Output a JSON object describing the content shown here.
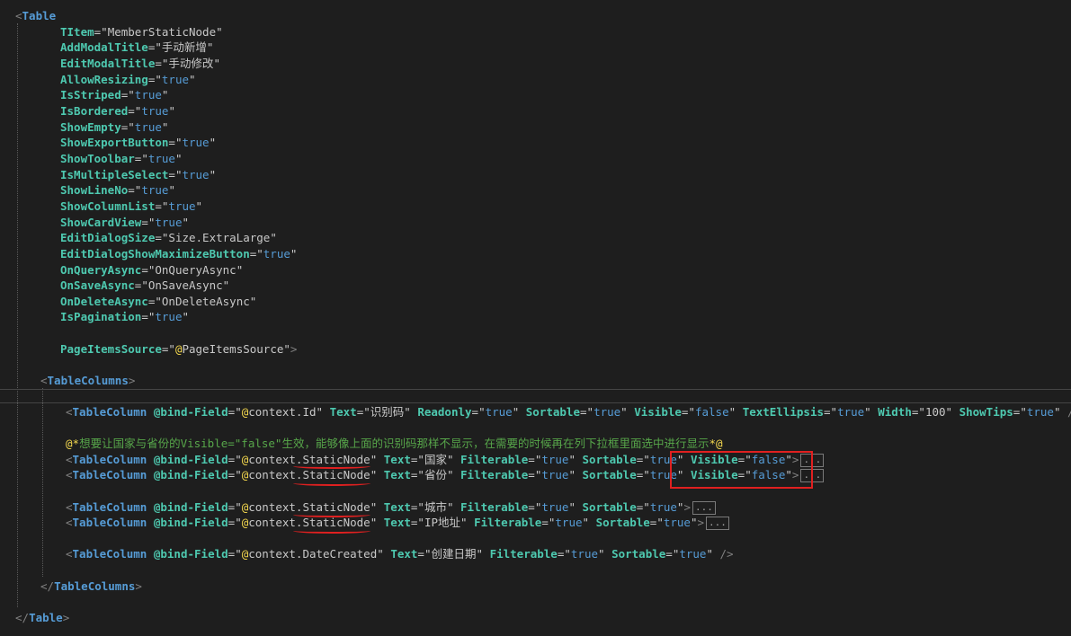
{
  "lines": [
    [
      [
        "t",
        "<"
      ],
      [
        "e",
        "Table"
      ]
    ],
    [
      [
        "a",
        "TItem"
      ],
      [
        "op",
        "="
      ],
      [
        "q",
        "\""
      ],
      [
        "s",
        "MemberStaticNode"
      ],
      [
        "q",
        "\""
      ]
    ],
    [
      [
        "a",
        "AddModalTitle"
      ],
      [
        "op",
        "="
      ],
      [
        "q",
        "\""
      ],
      [
        "s",
        "手动新增"
      ],
      [
        "q",
        "\""
      ]
    ],
    [
      [
        "a",
        "EditModalTitle"
      ],
      [
        "op",
        "="
      ],
      [
        "q",
        "\""
      ],
      [
        "s",
        "手动修改"
      ],
      [
        "q",
        "\""
      ]
    ],
    [
      [
        "a",
        "AllowResizing"
      ],
      [
        "op",
        "="
      ],
      [
        "q",
        "\""
      ],
      [
        "v",
        "true"
      ],
      [
        "q",
        "\""
      ]
    ],
    [
      [
        "a",
        "IsStriped"
      ],
      [
        "op",
        "="
      ],
      [
        "q",
        "\""
      ],
      [
        "v",
        "true"
      ],
      [
        "q",
        "\""
      ]
    ],
    [
      [
        "a",
        "IsBordered"
      ],
      [
        "op",
        "="
      ],
      [
        "q",
        "\""
      ],
      [
        "v",
        "true"
      ],
      [
        "q",
        "\""
      ]
    ],
    [
      [
        "a",
        "ShowEmpty"
      ],
      [
        "op",
        "="
      ],
      [
        "q",
        "\""
      ],
      [
        "v",
        "true"
      ],
      [
        "q",
        "\""
      ]
    ],
    [
      [
        "a",
        "ShowExportButton"
      ],
      [
        "op",
        "="
      ],
      [
        "q",
        "\""
      ],
      [
        "v",
        "true"
      ],
      [
        "q",
        "\""
      ]
    ],
    [
      [
        "a",
        "ShowToolbar"
      ],
      [
        "op",
        "="
      ],
      [
        "q",
        "\""
      ],
      [
        "v",
        "true"
      ],
      [
        "q",
        "\""
      ]
    ],
    [
      [
        "a",
        "IsMultipleSelect"
      ],
      [
        "op",
        "="
      ],
      [
        "q",
        "\""
      ],
      [
        "v",
        "true"
      ],
      [
        "q",
        "\""
      ]
    ],
    [
      [
        "a",
        "ShowLineNo"
      ],
      [
        "op",
        "="
      ],
      [
        "q",
        "\""
      ],
      [
        "v",
        "true"
      ],
      [
        "q",
        "\""
      ]
    ],
    [
      [
        "a",
        "ShowColumnList"
      ],
      [
        "op",
        "="
      ],
      [
        "q",
        "\""
      ],
      [
        "v",
        "true"
      ],
      [
        "q",
        "\""
      ]
    ],
    [
      [
        "a",
        "ShowCardView"
      ],
      [
        "op",
        "="
      ],
      [
        "q",
        "\""
      ],
      [
        "v",
        "true"
      ],
      [
        "q",
        "\""
      ]
    ],
    [
      [
        "a",
        "EditDialogSize"
      ],
      [
        "op",
        "="
      ],
      [
        "q",
        "\""
      ],
      [
        "s",
        "Size.ExtraLarge"
      ],
      [
        "q",
        "\""
      ]
    ],
    [
      [
        "a",
        "EditDialogShowMaximizeButton"
      ],
      [
        "op",
        "="
      ],
      [
        "q",
        "\""
      ],
      [
        "v",
        "true"
      ],
      [
        "q",
        "\""
      ]
    ],
    [
      [
        "a",
        "OnQueryAsync"
      ],
      [
        "op",
        "="
      ],
      [
        "q",
        "\""
      ],
      [
        "s",
        "OnQueryAsync"
      ],
      [
        "q",
        "\""
      ]
    ],
    [
      [
        "a",
        "OnSaveAsync"
      ],
      [
        "op",
        "="
      ],
      [
        "q",
        "\""
      ],
      [
        "s",
        "OnSaveAsync"
      ],
      [
        "q",
        "\""
      ]
    ],
    [
      [
        "a",
        "OnDeleteAsync"
      ],
      [
        "op",
        "="
      ],
      [
        "q",
        "\""
      ],
      [
        "s",
        "OnDeleteAsync"
      ],
      [
        "q",
        "\""
      ]
    ],
    [
      [
        "a",
        "IsPagination"
      ],
      [
        "op",
        "="
      ],
      [
        "q",
        "\""
      ],
      [
        "v",
        "true"
      ],
      [
        "q",
        "\""
      ]
    ],
    [
      [
        "a",
        "PageItemsSource"
      ],
      [
        "op",
        "="
      ],
      [
        "q",
        "\""
      ],
      [
        "at",
        "@"
      ],
      [
        "s",
        "PageItemsSource"
      ],
      [
        "q",
        "\""
      ],
      [
        "t",
        ">"
      ]
    ],
    [
      [
        "t",
        "<"
      ],
      [
        "e",
        "TableColumns"
      ],
      [
        "t",
        ">"
      ]
    ],
    [
      [
        "t",
        "<"
      ],
      [
        "e",
        "TableColumn"
      ],
      [
        "op",
        " "
      ],
      [
        "a",
        "@bind-Field"
      ],
      [
        "op",
        "="
      ],
      [
        "q",
        "\""
      ],
      [
        "at",
        "@"
      ],
      [
        "s",
        "context.Id"
      ],
      [
        "q",
        "\""
      ],
      [
        "op",
        " "
      ],
      [
        "a",
        "Text"
      ],
      [
        "op",
        "="
      ],
      [
        "q",
        "\""
      ],
      [
        "s",
        "识别码"
      ],
      [
        "q",
        "\""
      ],
      [
        "op",
        " "
      ],
      [
        "a",
        "Readonly"
      ],
      [
        "op",
        "="
      ],
      [
        "q",
        "\""
      ],
      [
        "v",
        "true"
      ],
      [
        "q",
        "\""
      ],
      [
        "op",
        " "
      ],
      [
        "a",
        "Sortable"
      ],
      [
        "op",
        "="
      ],
      [
        "q",
        "\""
      ],
      [
        "v",
        "true"
      ],
      [
        "q",
        "\""
      ],
      [
        "op",
        " "
      ],
      [
        "a",
        "Visible"
      ],
      [
        "op",
        "="
      ],
      [
        "q",
        "\""
      ],
      [
        "v",
        "false"
      ],
      [
        "q",
        "\""
      ],
      [
        "op",
        " "
      ],
      [
        "a",
        "TextEllipsis"
      ],
      [
        "op",
        "="
      ],
      [
        "q",
        "\""
      ],
      [
        "v",
        "true"
      ],
      [
        "q",
        "\""
      ],
      [
        "op",
        " "
      ],
      [
        "a",
        "Width"
      ],
      [
        "op",
        "="
      ],
      [
        "q",
        "\""
      ],
      [
        "s",
        "100"
      ],
      [
        "q",
        "\""
      ],
      [
        "op",
        " "
      ],
      [
        "a",
        "ShowTips"
      ],
      [
        "op",
        "="
      ],
      [
        "q",
        "\""
      ],
      [
        "v",
        "true"
      ],
      [
        "q",
        "\""
      ],
      [
        "op",
        " "
      ],
      [
        "t",
        "/>"
      ]
    ],
    [
      [
        "cm",
        "@*"
      ],
      [
        "c",
        "想要让国家与省份的Visible=\"false\"生效，能够像上面的识别码那样不显示，在需要的时候再在列下拉框里面选中进行显示"
      ],
      [
        "cm",
        "*@"
      ]
    ],
    [
      [
        "t",
        "<"
      ],
      [
        "e",
        "TableColumn"
      ],
      [
        "op",
        " "
      ],
      [
        "a",
        "@bind-Field"
      ],
      [
        "op",
        "="
      ],
      [
        "q",
        "\""
      ],
      [
        "at",
        "@"
      ],
      [
        "s",
        "context.StaticNode"
      ],
      [
        "q",
        "\""
      ],
      [
        "op",
        " "
      ],
      [
        "a",
        "Text"
      ],
      [
        "op",
        "="
      ],
      [
        "q",
        "\""
      ],
      [
        "s",
        "国家"
      ],
      [
        "q",
        "\""
      ],
      [
        "op",
        " "
      ],
      [
        "a",
        "Filterable"
      ],
      [
        "op",
        "="
      ],
      [
        "q",
        "\""
      ],
      [
        "v",
        "true"
      ],
      [
        "q",
        "\""
      ],
      [
        "op",
        " "
      ],
      [
        "a",
        "Sortable"
      ],
      [
        "op",
        "="
      ],
      [
        "q",
        "\""
      ],
      [
        "v",
        "true"
      ],
      [
        "q",
        "\""
      ],
      [
        "op",
        " "
      ],
      [
        "a",
        "Visible"
      ],
      [
        "op",
        "="
      ],
      [
        "q",
        "\""
      ],
      [
        "v",
        "false"
      ],
      [
        "q",
        "\""
      ],
      [
        "t",
        ">"
      ],
      [
        "coll",
        "..."
      ]
    ],
    [
      [
        "t",
        "<"
      ],
      [
        "e",
        "TableColumn"
      ],
      [
        "op",
        " "
      ],
      [
        "a",
        "@bind-Field"
      ],
      [
        "op",
        "="
      ],
      [
        "q",
        "\""
      ],
      [
        "at",
        "@"
      ],
      [
        "s",
        "context.StaticNode"
      ],
      [
        "q",
        "\""
      ],
      [
        "op",
        " "
      ],
      [
        "a",
        "Text"
      ],
      [
        "op",
        "="
      ],
      [
        "q",
        "\""
      ],
      [
        "s",
        "省份"
      ],
      [
        "q",
        "\""
      ],
      [
        "op",
        " "
      ],
      [
        "a",
        "Filterable"
      ],
      [
        "op",
        "="
      ],
      [
        "q",
        "\""
      ],
      [
        "v",
        "true"
      ],
      [
        "q",
        "\""
      ],
      [
        "op",
        " "
      ],
      [
        "a",
        "Sortable"
      ],
      [
        "op",
        "="
      ],
      [
        "q",
        "\""
      ],
      [
        "v",
        "true"
      ],
      [
        "q",
        "\""
      ],
      [
        "op",
        " "
      ],
      [
        "a",
        "Visible"
      ],
      [
        "op",
        "="
      ],
      [
        "q",
        "\""
      ],
      [
        "v",
        "false"
      ],
      [
        "q",
        "\""
      ],
      [
        "t",
        ">"
      ],
      [
        "coll",
        "..."
      ]
    ],
    [
      [
        "t",
        "<"
      ],
      [
        "e",
        "TableColumn"
      ],
      [
        "op",
        " "
      ],
      [
        "a",
        "@bind-Field"
      ],
      [
        "op",
        "="
      ],
      [
        "q",
        "\""
      ],
      [
        "at",
        "@"
      ],
      [
        "s",
        "context.StaticNode"
      ],
      [
        "q",
        "\""
      ],
      [
        "op",
        " "
      ],
      [
        "a",
        "Text"
      ],
      [
        "op",
        "="
      ],
      [
        "q",
        "\""
      ],
      [
        "s",
        "城市"
      ],
      [
        "q",
        "\""
      ],
      [
        "op",
        " "
      ],
      [
        "a",
        "Filterable"
      ],
      [
        "op",
        "="
      ],
      [
        "q",
        "\""
      ],
      [
        "v",
        "true"
      ],
      [
        "q",
        "\""
      ],
      [
        "op",
        " "
      ],
      [
        "a",
        "Sortable"
      ],
      [
        "op",
        "="
      ],
      [
        "q",
        "\""
      ],
      [
        "v",
        "true"
      ],
      [
        "q",
        "\""
      ],
      [
        "t",
        ">"
      ],
      [
        "coll",
        "..."
      ]
    ],
    [
      [
        "t",
        "<"
      ],
      [
        "e",
        "TableColumn"
      ],
      [
        "op",
        " "
      ],
      [
        "a",
        "@bind-Field"
      ],
      [
        "op",
        "="
      ],
      [
        "q",
        "\""
      ],
      [
        "at",
        "@"
      ],
      [
        "s",
        "context.StaticNode"
      ],
      [
        "q",
        "\""
      ],
      [
        "op",
        " "
      ],
      [
        "a",
        "Text"
      ],
      [
        "op",
        "="
      ],
      [
        "q",
        "\""
      ],
      [
        "s",
        "IP地址"
      ],
      [
        "q",
        "\""
      ],
      [
        "op",
        " "
      ],
      [
        "a",
        "Filterable"
      ],
      [
        "op",
        "="
      ],
      [
        "q",
        "\""
      ],
      [
        "v",
        "true"
      ],
      [
        "q",
        "\""
      ],
      [
        "op",
        " "
      ],
      [
        "a",
        "Sortable"
      ],
      [
        "op",
        "="
      ],
      [
        "q",
        "\""
      ],
      [
        "v",
        "true"
      ],
      [
        "q",
        "\""
      ],
      [
        "t",
        ">"
      ],
      [
        "coll",
        "..."
      ]
    ],
    [
      [
        "t",
        "<"
      ],
      [
        "e",
        "TableColumn"
      ],
      [
        "op",
        " "
      ],
      [
        "a",
        "@bind-Field"
      ],
      [
        "op",
        "="
      ],
      [
        "q",
        "\""
      ],
      [
        "at",
        "@"
      ],
      [
        "s",
        "context.DateCreated"
      ],
      [
        "q",
        "\""
      ],
      [
        "op",
        " "
      ],
      [
        "a",
        "Text"
      ],
      [
        "op",
        "="
      ],
      [
        "q",
        "\""
      ],
      [
        "s",
        "创建日期"
      ],
      [
        "q",
        "\""
      ],
      [
        "op",
        " "
      ],
      [
        "a",
        "Filterable"
      ],
      [
        "op",
        "="
      ],
      [
        "q",
        "\""
      ],
      [
        "v",
        "true"
      ],
      [
        "q",
        "\""
      ],
      [
        "op",
        " "
      ],
      [
        "a",
        "Sortable"
      ],
      [
        "op",
        "="
      ],
      [
        "q",
        "\""
      ],
      [
        "v",
        "true"
      ],
      [
        "q",
        "\""
      ],
      [
        "op",
        " "
      ],
      [
        "t",
        "/>"
      ]
    ],
    [
      [
        "t",
        "</"
      ],
      [
        "e",
        "TableColumns"
      ],
      [
        "t",
        ">"
      ]
    ],
    [
      [
        "t",
        "</"
      ],
      [
        "e",
        "Table"
      ],
      [
        "t",
        ">"
      ]
    ]
  ]
}
